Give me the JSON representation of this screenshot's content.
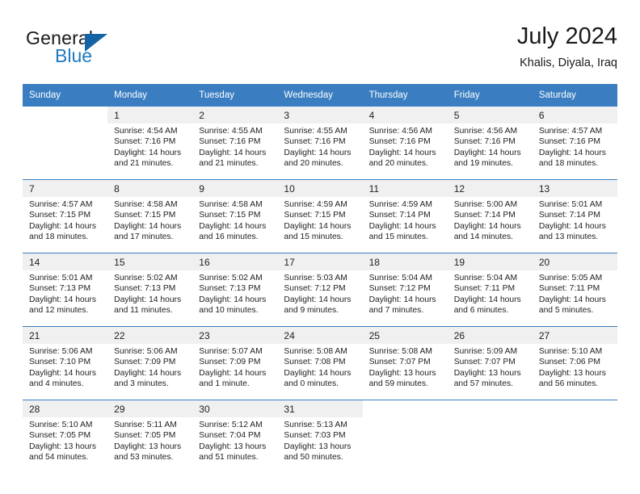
{
  "brand": {
    "general": "General",
    "blue": "Blue",
    "triangle_icon": "triangle-icon",
    "accent_color": "#1464a5",
    "blue_text_color": "#1f7ac0"
  },
  "header": {
    "title": "July 2024",
    "subtitle": "Khalis, Diyala, Iraq"
  },
  "theme": {
    "header_row_bg": "#3a7ec1",
    "daynum_shade_bg": "#f0f0f0",
    "text_color": "#222222"
  },
  "weekday_headers": [
    "Sunday",
    "Monday",
    "Tuesday",
    "Wednesday",
    "Thursday",
    "Friday",
    "Saturday"
  ],
  "labels": {
    "sunrise_prefix": "Sunrise:",
    "sunset_prefix": "Sunset:",
    "daylight_prefix": "Daylight:"
  },
  "weeks": [
    [
      {
        "day": "",
        "sunrise": "",
        "sunset": "",
        "daylight_line1": "",
        "daylight_line2": "",
        "empty": true
      },
      {
        "day": "1",
        "sunrise": "Sunrise: 4:54 AM",
        "sunset": "Sunset: 7:16 PM",
        "daylight_line1": "Daylight: 14 hours",
        "daylight_line2": "and 21 minutes."
      },
      {
        "day": "2",
        "sunrise": "Sunrise: 4:55 AM",
        "sunset": "Sunset: 7:16 PM",
        "daylight_line1": "Daylight: 14 hours",
        "daylight_line2": "and 21 minutes."
      },
      {
        "day": "3",
        "sunrise": "Sunrise: 4:55 AM",
        "sunset": "Sunset: 7:16 PM",
        "daylight_line1": "Daylight: 14 hours",
        "daylight_line2": "and 20 minutes."
      },
      {
        "day": "4",
        "sunrise": "Sunrise: 4:56 AM",
        "sunset": "Sunset: 7:16 PM",
        "daylight_line1": "Daylight: 14 hours",
        "daylight_line2": "and 20 minutes."
      },
      {
        "day": "5",
        "sunrise": "Sunrise: 4:56 AM",
        "sunset": "Sunset: 7:16 PM",
        "daylight_line1": "Daylight: 14 hours",
        "daylight_line2": "and 19 minutes."
      },
      {
        "day": "6",
        "sunrise": "Sunrise: 4:57 AM",
        "sunset": "Sunset: 7:16 PM",
        "daylight_line1": "Daylight: 14 hours",
        "daylight_line2": "and 18 minutes."
      }
    ],
    [
      {
        "day": "7",
        "sunrise": "Sunrise: 4:57 AM",
        "sunset": "Sunset: 7:15 PM",
        "daylight_line1": "Daylight: 14 hours",
        "daylight_line2": "and 18 minutes."
      },
      {
        "day": "8",
        "sunrise": "Sunrise: 4:58 AM",
        "sunset": "Sunset: 7:15 PM",
        "daylight_line1": "Daylight: 14 hours",
        "daylight_line2": "and 17 minutes."
      },
      {
        "day": "9",
        "sunrise": "Sunrise: 4:58 AM",
        "sunset": "Sunset: 7:15 PM",
        "daylight_line1": "Daylight: 14 hours",
        "daylight_line2": "and 16 minutes."
      },
      {
        "day": "10",
        "sunrise": "Sunrise: 4:59 AM",
        "sunset": "Sunset: 7:15 PM",
        "daylight_line1": "Daylight: 14 hours",
        "daylight_line2": "and 15 minutes."
      },
      {
        "day": "11",
        "sunrise": "Sunrise: 4:59 AM",
        "sunset": "Sunset: 7:14 PM",
        "daylight_line1": "Daylight: 14 hours",
        "daylight_line2": "and 15 minutes."
      },
      {
        "day": "12",
        "sunrise": "Sunrise: 5:00 AM",
        "sunset": "Sunset: 7:14 PM",
        "daylight_line1": "Daylight: 14 hours",
        "daylight_line2": "and 14 minutes."
      },
      {
        "day": "13",
        "sunrise": "Sunrise: 5:01 AM",
        "sunset": "Sunset: 7:14 PM",
        "daylight_line1": "Daylight: 14 hours",
        "daylight_line2": "and 13 minutes."
      }
    ],
    [
      {
        "day": "14",
        "sunrise": "Sunrise: 5:01 AM",
        "sunset": "Sunset: 7:13 PM",
        "daylight_line1": "Daylight: 14 hours",
        "daylight_line2": "and 12 minutes."
      },
      {
        "day": "15",
        "sunrise": "Sunrise: 5:02 AM",
        "sunset": "Sunset: 7:13 PM",
        "daylight_line1": "Daylight: 14 hours",
        "daylight_line2": "and 11 minutes."
      },
      {
        "day": "16",
        "sunrise": "Sunrise: 5:02 AM",
        "sunset": "Sunset: 7:13 PM",
        "daylight_line1": "Daylight: 14 hours",
        "daylight_line2": "and 10 minutes."
      },
      {
        "day": "17",
        "sunrise": "Sunrise: 5:03 AM",
        "sunset": "Sunset: 7:12 PM",
        "daylight_line1": "Daylight: 14 hours",
        "daylight_line2": "and 9 minutes."
      },
      {
        "day": "18",
        "sunrise": "Sunrise: 5:04 AM",
        "sunset": "Sunset: 7:12 PM",
        "daylight_line1": "Daylight: 14 hours",
        "daylight_line2": "and 7 minutes."
      },
      {
        "day": "19",
        "sunrise": "Sunrise: 5:04 AM",
        "sunset": "Sunset: 7:11 PM",
        "daylight_line1": "Daylight: 14 hours",
        "daylight_line2": "and 6 minutes."
      },
      {
        "day": "20",
        "sunrise": "Sunrise: 5:05 AM",
        "sunset": "Sunset: 7:11 PM",
        "daylight_line1": "Daylight: 14 hours",
        "daylight_line2": "and 5 minutes."
      }
    ],
    [
      {
        "day": "21",
        "sunrise": "Sunrise: 5:06 AM",
        "sunset": "Sunset: 7:10 PM",
        "daylight_line1": "Daylight: 14 hours",
        "daylight_line2": "and 4 minutes."
      },
      {
        "day": "22",
        "sunrise": "Sunrise: 5:06 AM",
        "sunset": "Sunset: 7:09 PM",
        "daylight_line1": "Daylight: 14 hours",
        "daylight_line2": "and 3 minutes."
      },
      {
        "day": "23",
        "sunrise": "Sunrise: 5:07 AM",
        "sunset": "Sunset: 7:09 PM",
        "daylight_line1": "Daylight: 14 hours",
        "daylight_line2": "and 1 minute."
      },
      {
        "day": "24",
        "sunrise": "Sunrise: 5:08 AM",
        "sunset": "Sunset: 7:08 PM",
        "daylight_line1": "Daylight: 14 hours",
        "daylight_line2": "and 0 minutes."
      },
      {
        "day": "25",
        "sunrise": "Sunrise: 5:08 AM",
        "sunset": "Sunset: 7:07 PM",
        "daylight_line1": "Daylight: 13 hours",
        "daylight_line2": "and 59 minutes."
      },
      {
        "day": "26",
        "sunrise": "Sunrise: 5:09 AM",
        "sunset": "Sunset: 7:07 PM",
        "daylight_line1": "Daylight: 13 hours",
        "daylight_line2": "and 57 minutes."
      },
      {
        "day": "27",
        "sunrise": "Sunrise: 5:10 AM",
        "sunset": "Sunset: 7:06 PM",
        "daylight_line1": "Daylight: 13 hours",
        "daylight_line2": "and 56 minutes."
      }
    ],
    [
      {
        "day": "28",
        "sunrise": "Sunrise: 5:10 AM",
        "sunset": "Sunset: 7:05 PM",
        "daylight_line1": "Daylight: 13 hours",
        "daylight_line2": "and 54 minutes."
      },
      {
        "day": "29",
        "sunrise": "Sunrise: 5:11 AM",
        "sunset": "Sunset: 7:05 PM",
        "daylight_line1": "Daylight: 13 hours",
        "daylight_line2": "and 53 minutes."
      },
      {
        "day": "30",
        "sunrise": "Sunrise: 5:12 AM",
        "sunset": "Sunset: 7:04 PM",
        "daylight_line1": "Daylight: 13 hours",
        "daylight_line2": "and 51 minutes."
      },
      {
        "day": "31",
        "sunrise": "Sunrise: 5:13 AM",
        "sunset": "Sunset: 7:03 PM",
        "daylight_line1": "Daylight: 13 hours",
        "daylight_line2": "and 50 minutes."
      },
      {
        "day": "",
        "sunrise": "",
        "sunset": "",
        "daylight_line1": "",
        "daylight_line2": "",
        "empty": true
      },
      {
        "day": "",
        "sunrise": "",
        "sunset": "",
        "daylight_line1": "",
        "daylight_line2": "",
        "empty": true
      },
      {
        "day": "",
        "sunrise": "",
        "sunset": "",
        "daylight_line1": "",
        "daylight_line2": "",
        "empty": true
      }
    ]
  ]
}
